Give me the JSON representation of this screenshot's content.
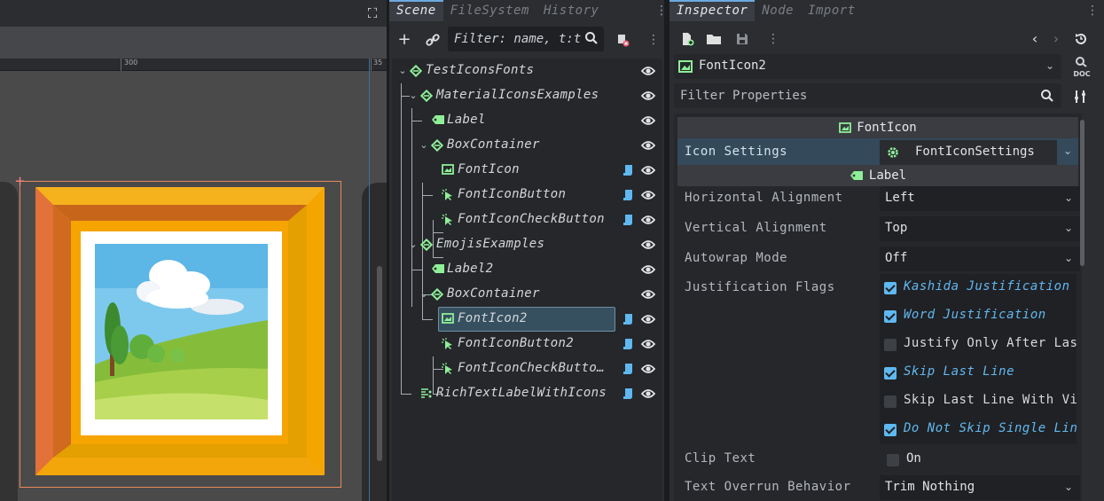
{
  "viewport": {
    "ruler_label": "300",
    "ruler_label_2": "35"
  },
  "scene": {
    "tabs": [
      "Scene",
      "FileSystem",
      "History"
    ],
    "filter_placeholder": "Filter: name, t:t",
    "tree": [
      {
        "label": "TestIconsFonts",
        "icon": "node2d-icon",
        "has_script": false
      },
      {
        "label": "MaterialIconsExamples",
        "icon": "node2d-icon",
        "has_script": false
      },
      {
        "label": "Label",
        "icon": "label-icon",
        "has_script": false
      },
      {
        "label": "BoxContainer",
        "icon": "node2d-icon",
        "has_script": false
      },
      {
        "label": "FontIcon",
        "icon": "texture-rect-icon",
        "has_script": true
      },
      {
        "label": "FontIconButton",
        "icon": "button-icon",
        "has_script": true
      },
      {
        "label": "FontIconCheckButton",
        "icon": "button-icon",
        "has_script": true
      },
      {
        "label": "EmojisExamples",
        "icon": "node2d-icon",
        "has_script": false
      },
      {
        "label": "Label2",
        "icon": "label-icon",
        "has_script": false
      },
      {
        "label": "BoxContainer",
        "icon": "node2d-icon",
        "has_script": false
      },
      {
        "label": "FontIcon2",
        "icon": "texture-rect-icon",
        "has_script": true
      },
      {
        "label": "FontIconButton2",
        "icon": "button-icon",
        "has_script": true
      },
      {
        "label": "FontIconCheckButto…",
        "icon": "button-icon",
        "has_script": true
      },
      {
        "label": "RichTextLabelWithIcons",
        "icon": "rich-text-icon",
        "has_script": true
      }
    ]
  },
  "inspector": {
    "tabs": [
      "Inspector",
      "Node",
      "Import"
    ],
    "node_name": "FontIcon2",
    "doc_label": "DOC",
    "filter_placeholder": "Filter Properties",
    "sections": {
      "fonticon": "FontIcon",
      "label": "Label"
    },
    "icon_settings": {
      "label": "Icon Settings",
      "value": "FontIconSettings"
    },
    "props": [
      {
        "label": "Horizontal Alignment",
        "value": "Left"
      },
      {
        "label": "Vertical Alignment",
        "value": "Top"
      },
      {
        "label": "Autowrap Mode",
        "value": "Off"
      }
    ],
    "justification": {
      "label": "Justification Flags",
      "flags": [
        {
          "text": "Kashida Justification",
          "checked": true
        },
        {
          "text": "Word Justification",
          "checked": true
        },
        {
          "text": "Justify Only After Las",
          "checked": false
        },
        {
          "text": "Skip Last Line",
          "checked": true
        },
        {
          "text": "Skip Last Line With Vi",
          "checked": false
        },
        {
          "text": "Do Not Skip Single Lin",
          "checked": true
        }
      ]
    },
    "clip_text": {
      "label": "Clip Text",
      "value": "On",
      "checked": false
    },
    "overrun": {
      "label": "Text Overrun Behavior",
      "value": "Trim Nothing"
    }
  },
  "colors": {
    "accent": "#6da9e0",
    "node_green": "#8eef97",
    "script_blue": "#5fb8f0",
    "selection": "#36505f"
  }
}
